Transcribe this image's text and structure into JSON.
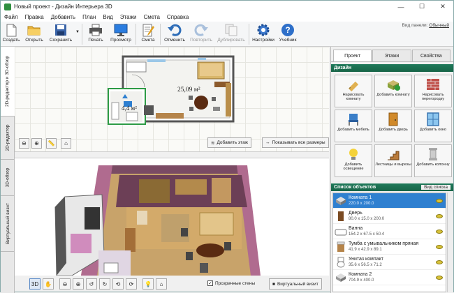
{
  "window": {
    "title": "Новый проект - Дизайн Интерьера 3D",
    "minimize": "—",
    "maximize": "☐",
    "close": "✕"
  },
  "menu": [
    "Файл",
    "Правка",
    "Добавить",
    "План",
    "Вид",
    "Этажи",
    "Смета",
    "Справка"
  ],
  "toolbar": {
    "buttons": [
      {
        "id": "create",
        "label": "Создать"
      },
      {
        "id": "open",
        "label": "Открыть"
      },
      {
        "id": "save",
        "label": "Сохранить"
      },
      {
        "id": "print",
        "label": "Печать"
      },
      {
        "id": "preview",
        "label": "Просмотр"
      },
      {
        "id": "estimate",
        "label": "Смета"
      },
      {
        "id": "undo",
        "label": "Отменить"
      },
      {
        "id": "redo",
        "label": "Повторить"
      },
      {
        "id": "duplicate",
        "label": "Дублировать"
      },
      {
        "id": "settings",
        "label": "Настройки"
      },
      {
        "id": "tutorial",
        "label": "Учебник"
      }
    ],
    "view_panel_label": "Вид панели:",
    "view_panel_value": "Обычный"
  },
  "left_tabs": [
    "2D-редактор и 3D-обзор",
    "2D-редактор",
    "3D-обзор",
    "Виртуальный визит"
  ],
  "plan": {
    "room1_area": "25,09 м²",
    "room2_area": "4,4 м²",
    "add_floor": "Добавить этаж",
    "show_sizes": "Показывать все размеры"
  },
  "view3d": {
    "transparent_walls": "Прозрачные стены",
    "virtual_visit": "Виртуальный визит"
  },
  "right_panel": {
    "tabs": [
      "Проект",
      "Этажи",
      "Свойства"
    ],
    "section_design": "Дизайн",
    "design_buttons": [
      {
        "label": "Нарисовать комнату"
      },
      {
        "label": "Добавить комнату"
      },
      {
        "label": "Нарисовать перегородку"
      },
      {
        "label": "Добавить мебель"
      },
      {
        "label": "Добавить дверь"
      },
      {
        "label": "Добавить окно"
      },
      {
        "label": "Добавить освещение"
      },
      {
        "label": "Лестницы и вырезы"
      },
      {
        "label": "Добавить колонну"
      }
    ],
    "objects_title": "Список объектов",
    "objects_view": "Вид списка",
    "objects": [
      {
        "name": "Комната 1",
        "dims": "220.0 x 200.0",
        "selected": true
      },
      {
        "name": "Дверь",
        "dims": "80.0 x 15.0 x 200.0",
        "selected": false
      },
      {
        "name": "Ванна",
        "dims": "154.2 x 67.5 x 50.4",
        "selected": false
      },
      {
        "name": "Тумба с умывальником пряная",
        "dims": "41.9 x 42.9 x 89.1",
        "selected": false
      },
      {
        "name": "Унитаз компакт",
        "dims": "35.6 x 56.5 x 71.2",
        "selected": false
      },
      {
        "name": "Комната 2",
        "dims": "704.9 x 400.0",
        "selected": false
      }
    ]
  }
}
